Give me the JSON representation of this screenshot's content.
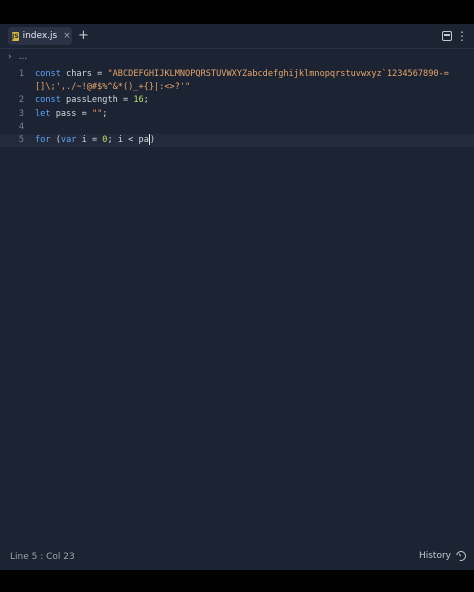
{
  "tab": {
    "filename": "index.js",
    "close": "×",
    "new_tab": "+"
  },
  "breadcrumb": {
    "chevron": "›",
    "path": "..."
  },
  "editor": {
    "lines": [
      {
        "num": "1"
      },
      {
        "num": ""
      },
      {
        "num": "2"
      },
      {
        "num": "3"
      },
      {
        "num": "4"
      },
      {
        "num": "5"
      }
    ],
    "line1": {
      "kw": "const",
      "name": " chars = ",
      "str": "\"ABCDEFGHIJKLMNOPQRSTUVWXYZabcdefghijklmnopqrstuvwxyz`1234567890-="
    },
    "line1b": {
      "str": "[]\\;',./~!@#$%^&*()_+{}|:<>?'\""
    },
    "line2": {
      "kw": "const",
      "name": " passLength = ",
      "num": "16",
      "end": ";"
    },
    "line3": {
      "kw": "let",
      "name": " pass = ",
      "str": "\"\"",
      "end": ";"
    },
    "line5": {
      "kw": "for",
      "open": " (",
      "kw2": "var",
      "name": " i = ",
      "num": "0",
      "rest": "; i < pa",
      "close": ")"
    }
  },
  "status": {
    "position": "Line 5 : Col 23",
    "history": "History"
  }
}
